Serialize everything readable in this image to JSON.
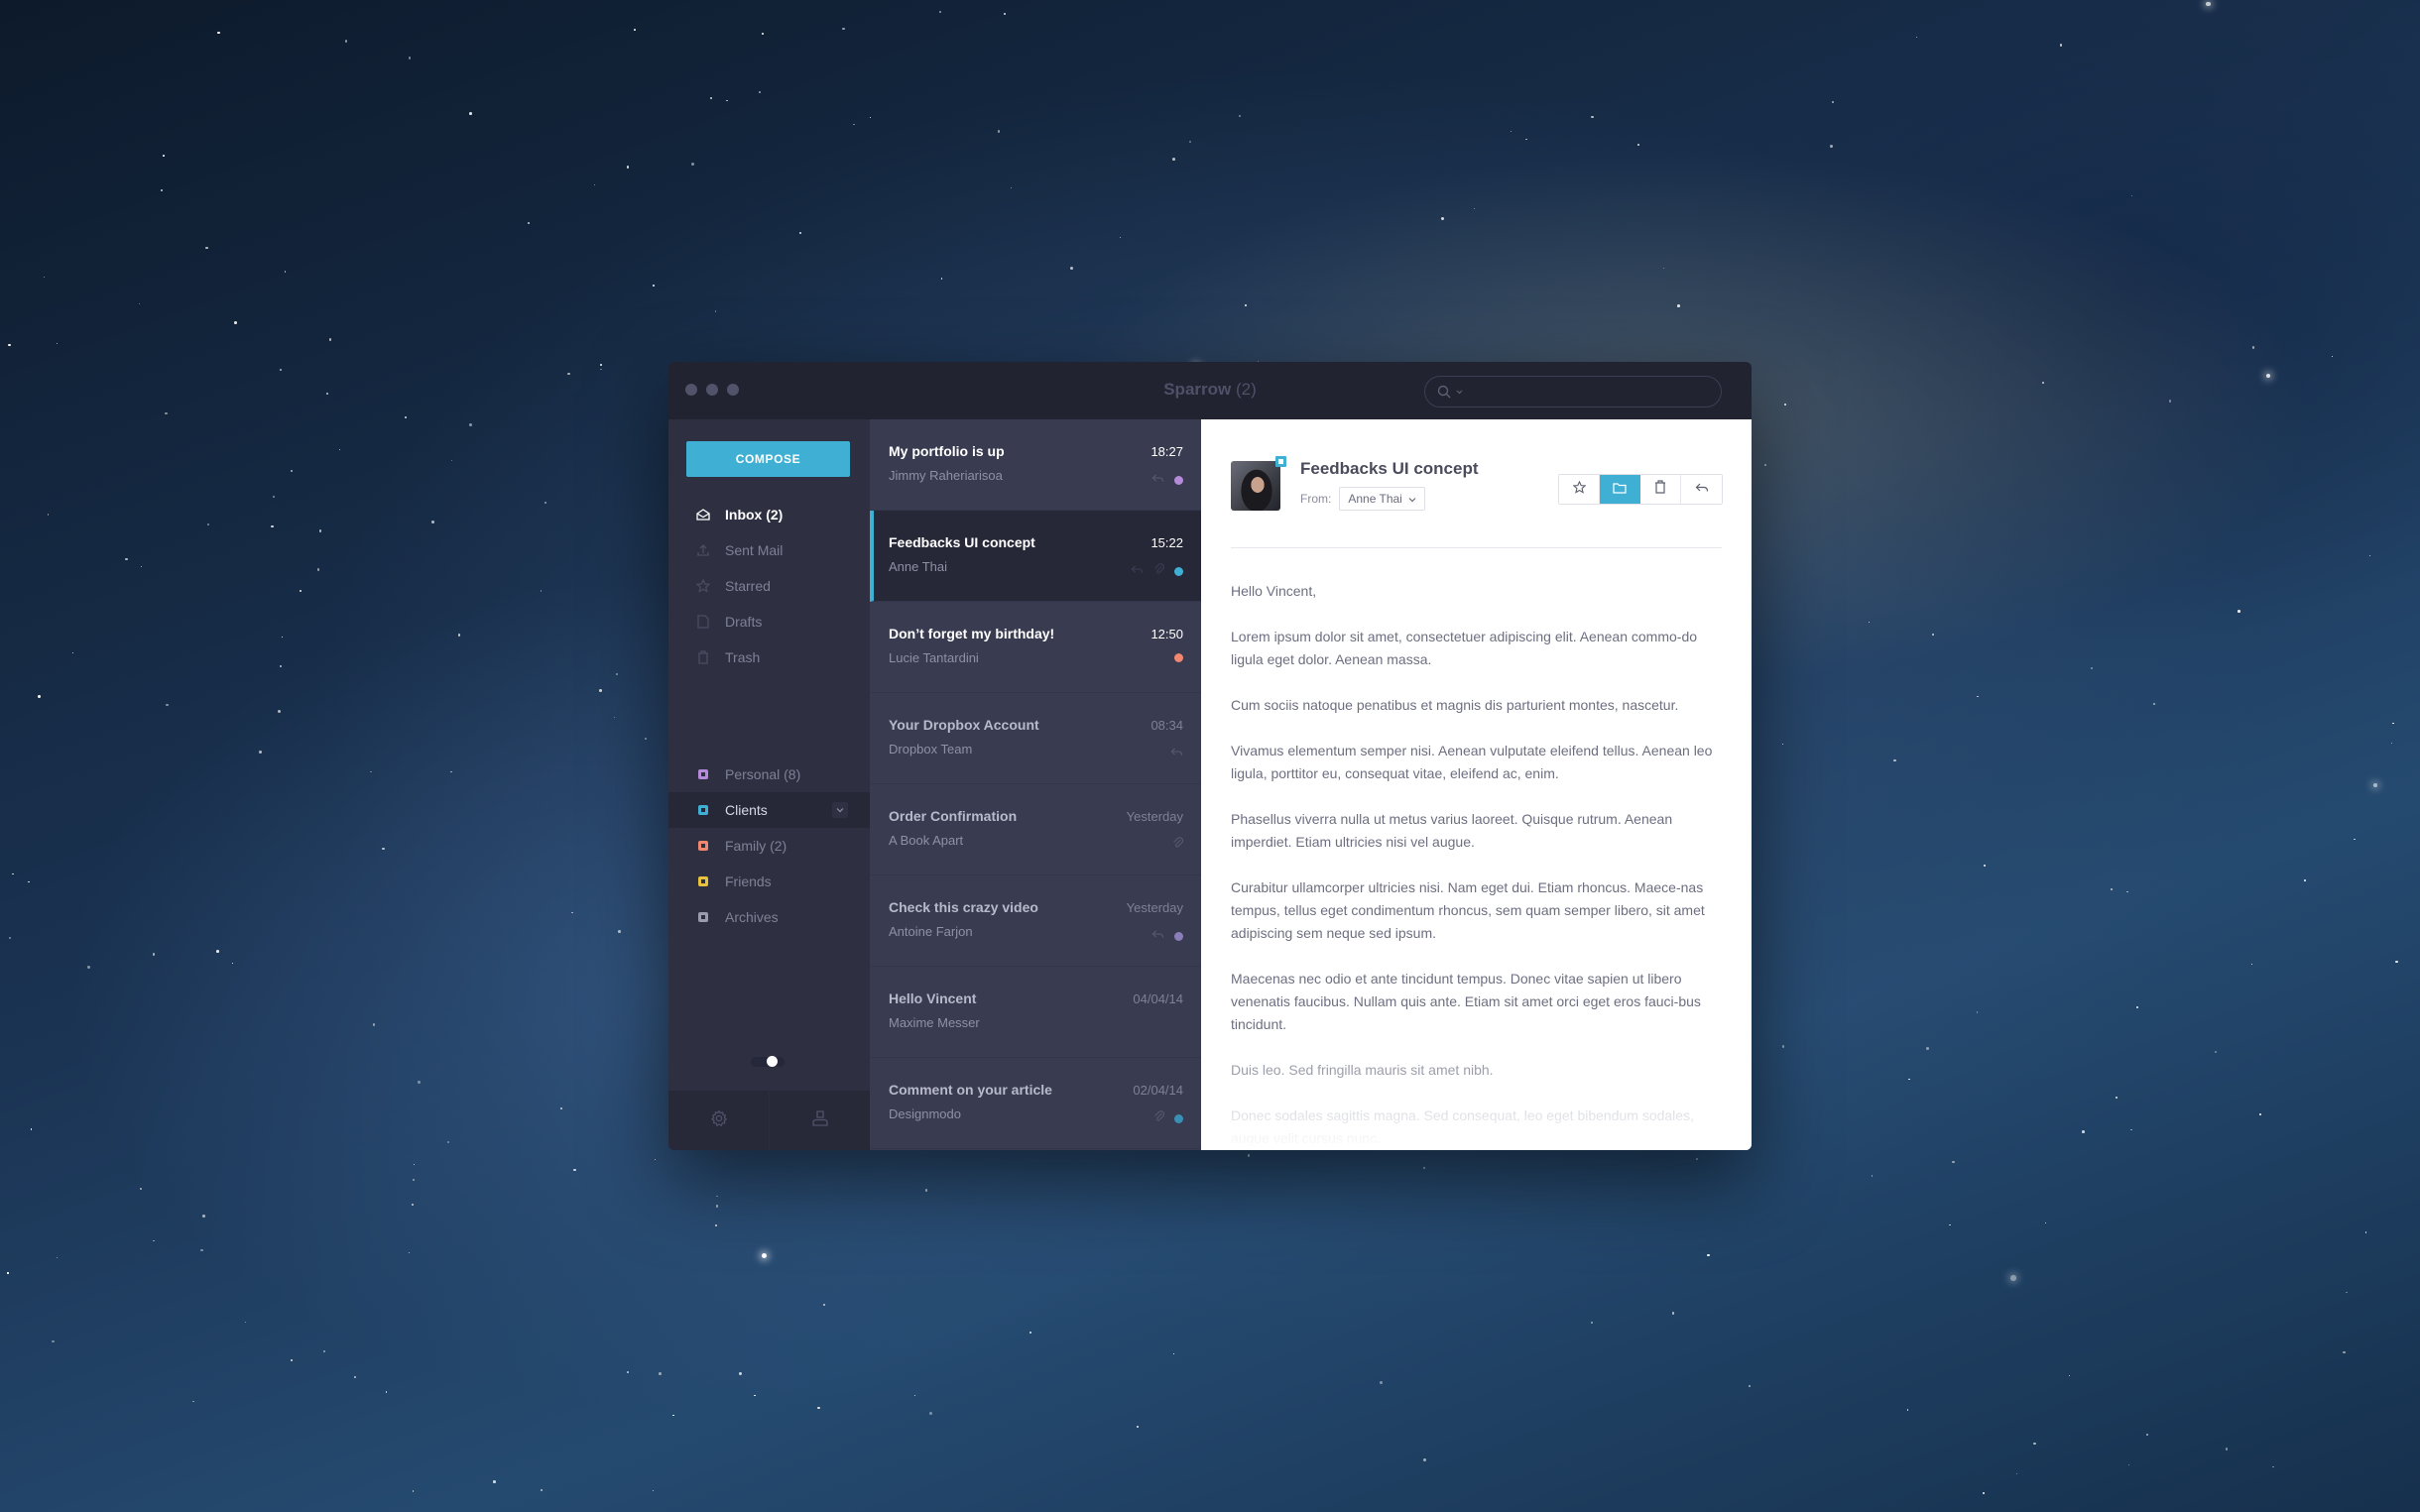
{
  "window": {
    "app_name": "Sparrow",
    "unread_count": "(2)",
    "search": {
      "placeholder": "",
      "value": ""
    }
  },
  "sidebar": {
    "compose_label": "COMPOSE",
    "mailboxes": [
      {
        "label": "Inbox (2)",
        "icon": "inbox-icon",
        "active": true
      },
      {
        "label": "Sent Mail",
        "icon": "upload-icon"
      },
      {
        "label": "Starred",
        "icon": "star-icon"
      },
      {
        "label": "Drafts",
        "icon": "document-icon"
      },
      {
        "label": "Trash",
        "icon": "trash-icon"
      }
    ],
    "labels": [
      {
        "label": "Personal (8)",
        "color": "#b48ad9"
      },
      {
        "label": "Clients",
        "color": "#3fb0d4",
        "selected": true
      },
      {
        "label": "Family (2)",
        "color": "#f0876e"
      },
      {
        "label": "Friends",
        "color": "#e8c23a"
      },
      {
        "label": "Archives",
        "color": "#9a9cad"
      }
    ],
    "toggle_on": true,
    "footer": {
      "settings_icon": "gear-icon",
      "account_icon": "user-icon"
    }
  },
  "messages": [
    {
      "subject": "My portfolio is up",
      "from": "Jimmy Raheriarisoa",
      "time": "18:27",
      "unread": true,
      "replied": true,
      "attachment": false,
      "dot": "#b48ad9"
    },
    {
      "subject": "Feedbacks UI concept",
      "from": "Anne Thai",
      "time": "15:22",
      "unread": true,
      "selected": true,
      "replied": true,
      "attachment": true,
      "dot": "#3fb0d4"
    },
    {
      "subject": "Don’t forget my birthday!",
      "from": "Lucie Tantardini",
      "time": "12:50",
      "unread": true,
      "replied": false,
      "attachment": false,
      "dot": "#f0876e"
    },
    {
      "subject": "Your Dropbox Account",
      "from": "Dropbox Team",
      "time": "08:34",
      "unread": false,
      "replied": true,
      "attachment": false,
      "dot": null
    },
    {
      "subject": "Order Confirmation",
      "from": "A Book Apart",
      "time": "Yesterday",
      "unread": false,
      "replied": false,
      "attachment": true,
      "dot": null
    },
    {
      "subject": "Check this crazy video",
      "from": "Antoine Farjon",
      "time": "Yesterday",
      "unread": false,
      "replied": true,
      "attachment": false,
      "dot": "#8a7db8"
    },
    {
      "subject": "Hello Vincent",
      "from": "Maxime Messer",
      "time": "04/04/14",
      "unread": false,
      "replied": false,
      "attachment": false,
      "dot": null
    },
    {
      "subject": "Comment on your article",
      "from": "Designmodo",
      "time": "02/04/14",
      "unread": false,
      "replied": false,
      "attachment": true,
      "dot": "#3a8fb5"
    }
  ],
  "reader": {
    "subject": "Feedbacks UI concept",
    "from_label": "From:",
    "from_name": "Anne Thai",
    "actions": [
      {
        "name": "star",
        "icon": "star-icon"
      },
      {
        "name": "move-to-folder",
        "icon": "folder-icon",
        "active": true
      },
      {
        "name": "delete",
        "icon": "trash-icon"
      },
      {
        "name": "reply",
        "icon": "reply-icon"
      }
    ],
    "paragraphs": [
      "Hello Vincent,",
      "Lorem ipsum dolor sit amet, consectetuer adipiscing elit. Aenean commo-do ligula eget dolor. Aenean massa.",
      "Cum sociis natoque penatibus et magnis dis parturient montes, nascetur.",
      "Vivamus elementum semper nisi. Aenean vulputate eleifend tellus. Aenean leo ligula, porttitor eu, consequat vitae, eleifend ac, enim.",
      "Phasellus viverra nulla ut metus varius laoreet. Quisque rutrum. Aenean imperdiet. Etiam ultricies nisi vel augue.",
      "Curabitur ullamcorper ultricies nisi. Nam eget dui. Etiam rhoncus. Maece-nas tempus, tellus eget condimentum rhoncus, sem quam semper libero, sit amet adipiscing sem neque sed ipsum.",
      "Maecenas nec odio et ante tincidunt tempus. Donec vitae sapien ut libero venenatis faucibus. Nullam quis ante. Etiam sit amet orci eget eros fauci-bus tincidunt.",
      "Duis leo. Sed fringilla mauris sit amet nibh.",
      "Donec sodales sagittis magna. Sed consequat, leo eget bibendum sodales, augue velit cursus nunc."
    ]
  },
  "colors": {
    "accent": "#3fb0d4",
    "titlebar": "#212331",
    "sidebar": "#2e3042",
    "list": "#393b50",
    "selected_row": "#262838"
  }
}
